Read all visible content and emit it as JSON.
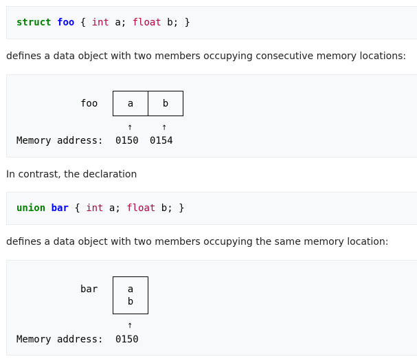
{
  "struct_code": {
    "keyword": "struct",
    "name": "foo",
    "open": " { ",
    "type_a": "int",
    "member_a": " a; ",
    "type_b": "float",
    "member_b": " b; }"
  },
  "paragraph_1": "defines a data object with two members occupying consecutive memory locations:",
  "struct_diagram": {
    "label": "foo",
    "cells": [
      "a",
      "b"
    ],
    "address_label": "Memory address:",
    "addresses": [
      "0150",
      "0154"
    ],
    "arrow": "↑"
  },
  "paragraph_2": "In contrast, the declaration",
  "union_code": {
    "keyword": "union",
    "name": "bar",
    "open": " { ",
    "type_a": "int",
    "member_a": " a; ",
    "type_b": "float",
    "member_b": " b; }"
  },
  "paragraph_3": "defines a data object with two members occupying the same memory location:",
  "union_diagram": {
    "label": "bar",
    "cells": [
      "a",
      "b"
    ],
    "address_label": "Memory address:",
    "addresses": [
      "0150"
    ],
    "arrow": "↑"
  },
  "colors": {
    "keyword": "#008000",
    "type_name": "#0000ff",
    "builtin_type": "#b00040",
    "code_background": "#f8f9fa"
  }
}
